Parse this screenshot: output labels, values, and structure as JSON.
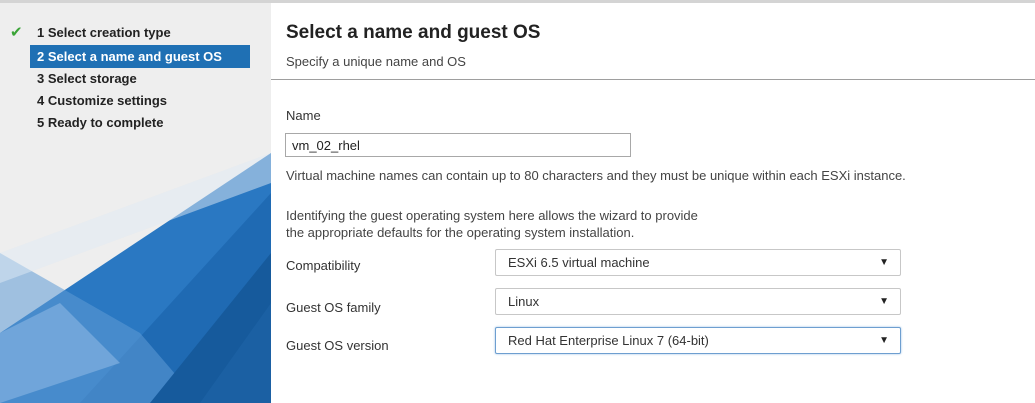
{
  "wizard": {
    "steps": [
      {
        "label": "1 Select creation type",
        "state": "completed"
      },
      {
        "label": "2 Select a name and guest OS",
        "state": "active"
      },
      {
        "label": "3 Select storage",
        "state": "pending"
      },
      {
        "label": "4 Customize settings",
        "state": "pending"
      },
      {
        "label": "5 Ready to complete",
        "state": "pending"
      }
    ],
    "check_icon": "✔"
  },
  "page": {
    "title": "Select a name and guest OS",
    "subtitle": "Specify a unique name and OS"
  },
  "form": {
    "name_label": "Name",
    "name_value": "vm_02_rhel",
    "name_help": "Virtual machine names can contain up to 80 characters and they must be unique within each ESXi instance.",
    "os_help_line1": "Identifying the guest operating system here allows the wizard to provide",
    "os_help_line2": "the appropriate defaults for the operating system installation.",
    "compatibility_label": "Compatibility",
    "compatibility_value": "ESXi 6.5 virtual machine",
    "os_family_label": "Guest OS family",
    "os_family_value": "Linux",
    "os_version_label": "Guest OS version",
    "os_version_value": "Red Hat Enterprise Linux 7 (64-bit)",
    "caret_icon": "▼"
  },
  "colors": {
    "active_step": "#1f70b4",
    "check": "#3aa437",
    "sidebar_bg": "#eeeeee",
    "art_blue_dark": "#1c64a8",
    "art_blue_light": "#4a8fd4"
  }
}
